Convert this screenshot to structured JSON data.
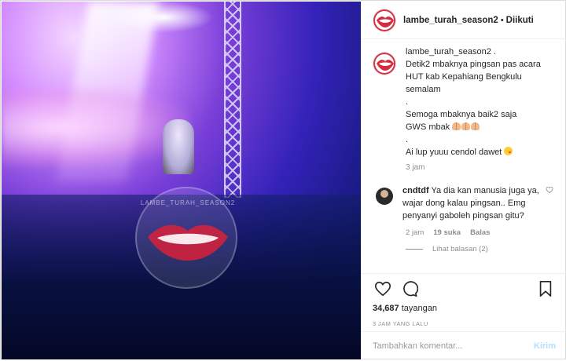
{
  "post": {
    "username": "lambe_turah_season2",
    "follow_status": "Diikuti",
    "separator": "•"
  },
  "caption": {
    "username": "lambe_turah_season2",
    "lines": [
      "Detik2 mbaknya pingsan pas acara",
      "HUT kab Kepahiang Bengkulu",
      "semalam",
      ".",
      "Semoga mbaknya baik2 saja",
      "GWS mbak",
      ".",
      "Ai lup yuuu cendol dawet"
    ],
    "time": "3 jam"
  },
  "comment": {
    "username": "cndtdf",
    "text": "Ya dia kan manusia juga ya, wajar dong kalau pingsan.. Emg penyanyi gaboleh pingsan gitu?",
    "time": "2 jam",
    "likes": "19 suka",
    "reply": "Balas",
    "view_replies": "Lihat balasan (2)"
  },
  "stats": {
    "views_count": "34,687",
    "views_label": "tayangan",
    "posted": "3 JAM YANG LALU"
  },
  "compose": {
    "placeholder": "Tambahkan komentar...",
    "post_label": "Kirim"
  },
  "watermark": {
    "text": "LAMBE_TURAH_SEASON2"
  },
  "icons": [
    "heart-icon",
    "comment-icon",
    "bookmark-icon",
    "comment-heart-icon"
  ],
  "colors": {
    "brand_red": "#d62b3f",
    "link_disabled": "#b2dffc",
    "muted": "#8e8e8e"
  }
}
